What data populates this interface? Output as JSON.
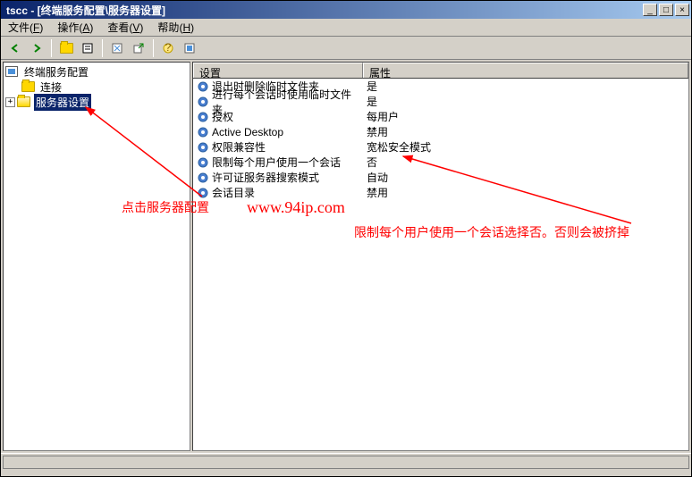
{
  "window": {
    "title": "tscc - [终端服务配置\\服务器设置]"
  },
  "menu": {
    "file": "文件",
    "file_u": "F",
    "action": "操作",
    "action_u": "A",
    "view": "查看",
    "view_u": "V",
    "help": "帮助",
    "help_u": "H"
  },
  "tree": {
    "root": "终端服务配置",
    "conn": "连接",
    "settings": "服务器设置"
  },
  "list": {
    "col_setting": "设置",
    "col_attr": "属性",
    "rows": [
      {
        "setting": "退出时删除临时文件夹",
        "attr": "是"
      },
      {
        "setting": "进行每个会话时使用临时文件夹",
        "attr": "是"
      },
      {
        "setting": "授权",
        "attr": "每用户"
      },
      {
        "setting": "Active Desktop",
        "attr": "禁用"
      },
      {
        "setting": "权限兼容性",
        "attr": "宽松安全模式"
      },
      {
        "setting": "限制每个用户使用一个会话",
        "attr": "否"
      },
      {
        "setting": "许可证服务器搜索模式",
        "attr": "自动"
      },
      {
        "setting": "会话目录",
        "attr": "禁用"
      }
    ]
  },
  "annotations": {
    "left": "点击服务器配置",
    "url": "www.94ip.com",
    "right": "限制每个用户使用一个会话选择否。否则会被挤掉"
  }
}
